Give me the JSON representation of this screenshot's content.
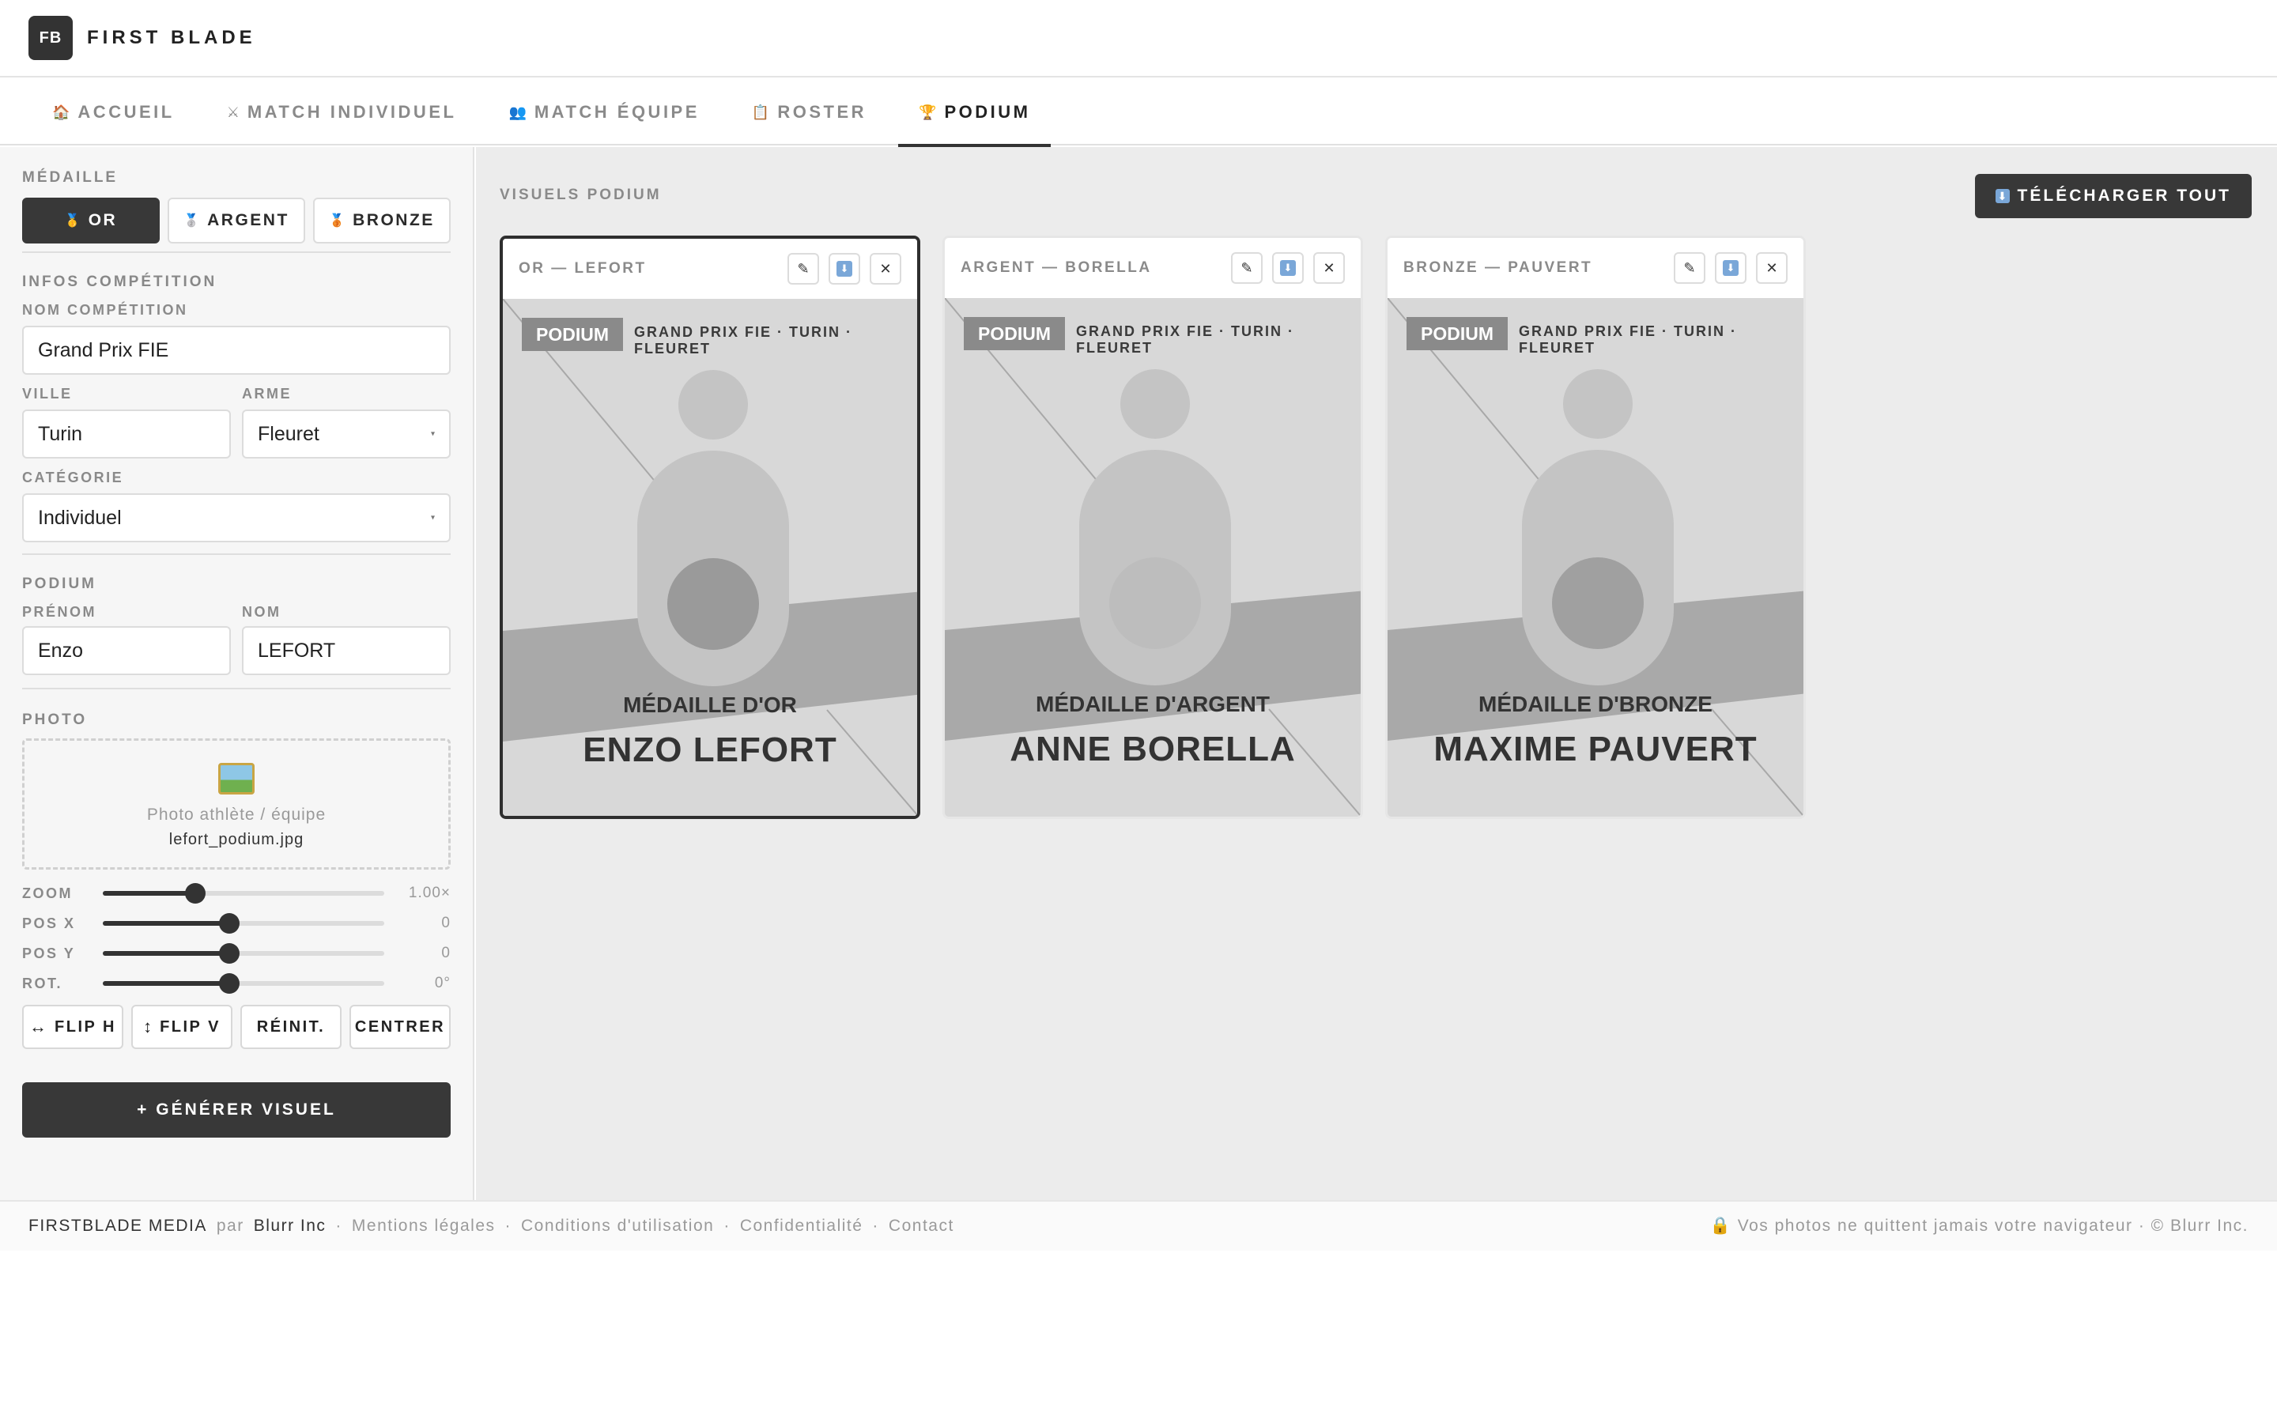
{
  "header": {
    "logo": "FB",
    "brand": "FIRST BLADE"
  },
  "tabs": [
    {
      "icon": "🏠",
      "label": "ACCUEIL"
    },
    {
      "icon": "⚔",
      "label": "MATCH INDIVIDUEL"
    },
    {
      "icon": "👥",
      "label": "MATCH ÉQUIPE"
    },
    {
      "icon": "📋",
      "label": "ROSTER"
    },
    {
      "icon": "🏆",
      "label": "PODIUM",
      "active": true
    }
  ],
  "sidebar": {
    "medal_label": "MÉDAILLE",
    "medals": [
      {
        "icon": "🥇",
        "label": "OR",
        "active": true
      },
      {
        "icon": "🥈",
        "label": "ARGENT"
      },
      {
        "icon": "🥉",
        "label": "BRONZE"
      }
    ],
    "comp_section": "INFOS COMPÉTITION",
    "comp_name_label": "NOM COMPÉTITION",
    "comp_name_value": "Grand Prix FIE",
    "city_label": "VILLE",
    "city_value": "Turin",
    "weapon_label": "ARME",
    "weapon_value": "Fleuret",
    "category_label": "CATÉGORIE",
    "category_value": "Individuel",
    "podium_section": "PODIUM",
    "firstname_label": "PRÉNOM",
    "firstname_value": "Enzo",
    "lastname_label": "NOM",
    "lastname_value": "LEFORT",
    "photo_section": "PHOTO",
    "dropzone_text": "Photo athlète / équipe",
    "dropzone_file": "lefort_podium.jpg",
    "sliders": [
      {
        "label": "ZOOM",
        "value": "1.00×",
        "fraction": 0.33
      },
      {
        "label": "POS X",
        "value": "0",
        "fraction": 0.45
      },
      {
        "label": "POS Y",
        "value": "0",
        "fraction": 0.45
      },
      {
        "label": "ROT.",
        "value": "0°",
        "fraction": 0.45
      }
    ],
    "tools": [
      {
        "icon": "↔",
        "label": "FLIP H"
      },
      {
        "icon": "↕",
        "label": "FLIP V"
      },
      {
        "icon": "",
        "label": "RÉINIT."
      },
      {
        "icon": "",
        "label": "CENTRER"
      }
    ],
    "generate_label": "+ GÉNÉRER VISUEL"
  },
  "main": {
    "title": "VISUELS PODIUM",
    "download_all": "TÉLÉCHARGER TOUT",
    "cards": [
      {
        "title": "OR — LEFORT",
        "badge": "PODIUM",
        "meta": "GRAND PRIX FIE · TURIN · FLEURET",
        "medal": "MÉDAILLE D'OR",
        "name": "ENZO LEFORT",
        "selected": true
      },
      {
        "title": "ARGENT — BORELLA",
        "badge": "PODIUM",
        "meta": "GRAND PRIX FIE · TURIN · FLEURET",
        "medal": "MÉDAILLE D'ARGENT",
        "name": "ANNE BORELLA"
      },
      {
        "title": "BRONZE — PAUVERT",
        "badge": "PODIUM",
        "meta": "GRAND PRIX FIE · TURIN · FLEURET",
        "medal": "MÉDAILLE D'BRONZE",
        "name": "MAXIME PAUVERT"
      }
    ],
    "card_actions": {
      "edit": "✎",
      "download": "⬇",
      "close": "✕"
    }
  },
  "footer": {
    "brand": "FIRSTBLADE MEDIA",
    "par": "par",
    "company": "Blurr Inc",
    "links": [
      "Mentions légales",
      "Conditions d'utilisation",
      "Confidentialité",
      "Contact"
    ],
    "right": "🔒 Vos photos ne quittent jamais votre navigateur · © Blurr Inc."
  }
}
